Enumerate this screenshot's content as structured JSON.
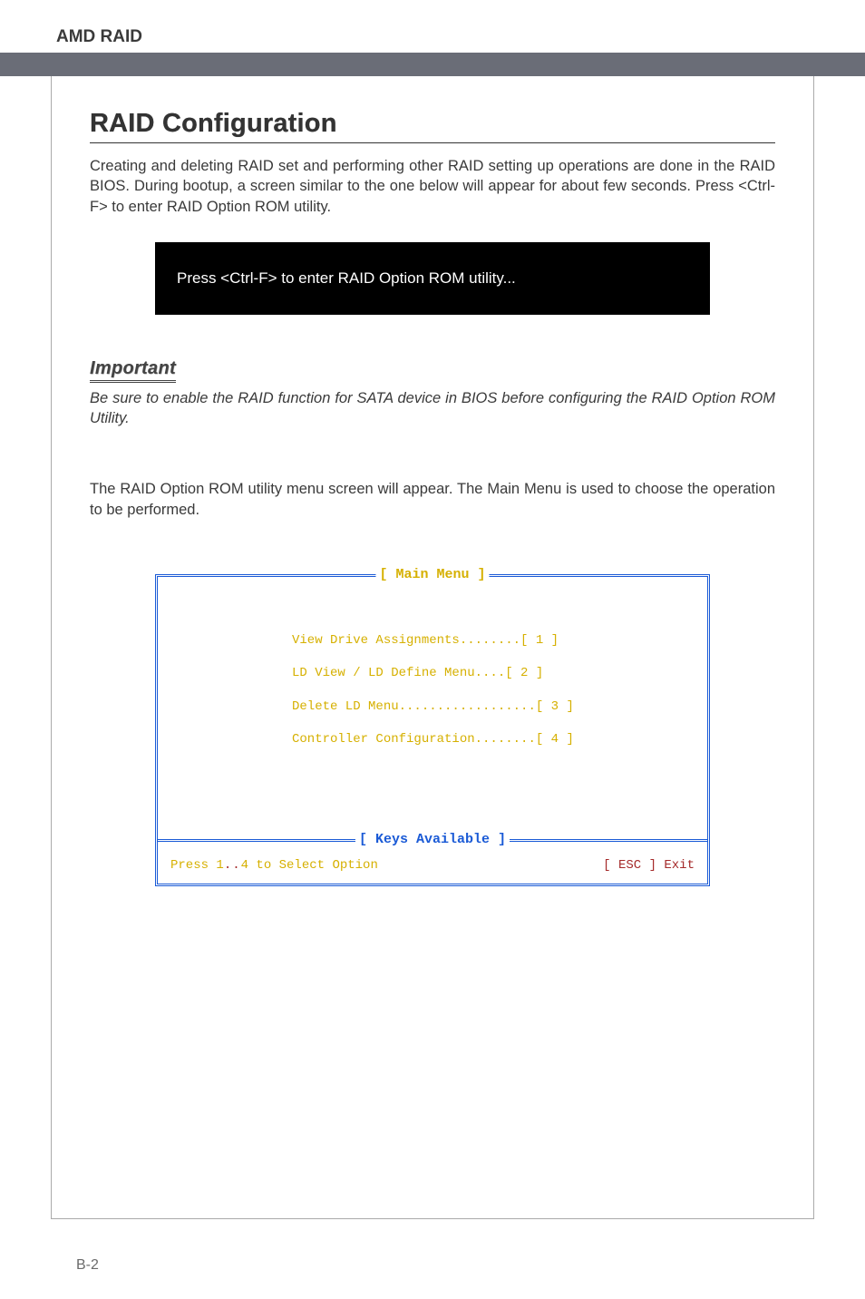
{
  "header": {
    "title": "AMD RAID"
  },
  "section_title": "RAID Configuration",
  "intro_text": "Creating and deleting RAID set and performing other RAID setting up operations are done in the RAID BIOS. During bootup, a screen similar to the one below will appear for about few seconds. Press <Ctrl-F> to enter RAID Option ROM utility.",
  "callout_text": "Press <Ctrl-F> to enter RAID Option ROM utility...",
  "important_label": "Important",
  "important_text": "Be sure to enable the RAID function for SATA device in BIOS before configuring the RAID Option ROM Utility.",
  "body_text2": "The RAID Option ROM utility menu screen will appear. The Main Menu is used to choose the operation to be performed.",
  "bios": {
    "main_title": "[ Main Menu ]",
    "items": [
      "View Drive Assignments........[  1  ]",
      "LD View / LD Define Menu....[  2  ]",
      "Delete LD Menu..................[  3  ]",
      "Controller Configuration........[  4  ]"
    ],
    "keys_title": "[ Keys Available ]",
    "keys_left_pre": "Press 1",
    "keys_dots": "..",
    "keys_left_post": "4 to Select Option",
    "keys_right": "[ ESC ]  Exit"
  },
  "page_number": "B-2"
}
